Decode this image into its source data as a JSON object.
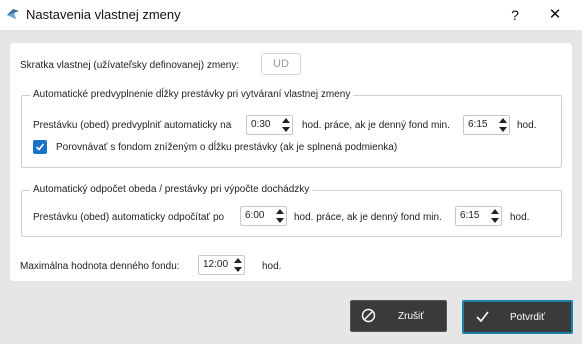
{
  "window": {
    "title": "Nastavenia vlastnej zmeny",
    "help_label": "?",
    "close_label": "✕",
    "app_icon": "app-logo-icon"
  },
  "shortcut": {
    "label": "Skratka vlastnej (užívateľsky definovanej) zmeny:",
    "value": "UD"
  },
  "auto_fill": {
    "legend": "Automatické predvyplnenie dĺžky prestávky pri vytváraní vlastnej zmeny",
    "prefix": "Prestávku (obed) predvyplniť automaticky na",
    "break_value": "0:30",
    "middle": "hod. práce, ak je denný fond min.",
    "fund_value": "6:15",
    "suffix": "hod.",
    "compare_label": "Porovnávať s fondom zníženým o dĺžku prestávky (ak je splnená podmienka)",
    "compare_checked": true
  },
  "auto_deduct": {
    "legend": "Automatický odpočet obeda / prestávky pri výpočte dochádzky",
    "prefix": "Prestávku (obed) automaticky odpočítať po",
    "after_value": "6:00",
    "middle": "hod. práce, ak je denný fond min.",
    "fund_value": "6:15",
    "suffix": "hod."
  },
  "max_fund": {
    "label": "Maximálna hodnota denného fondu:",
    "value": "12:00",
    "suffix": "hod."
  },
  "buttons": {
    "cancel_label": "Zrušiť",
    "confirm_label": "Potvrdiť"
  },
  "colors": {
    "accent": "#1a73c8",
    "confirm_border": "#1f7fa6",
    "button_bg": "#3a3a3a"
  }
}
